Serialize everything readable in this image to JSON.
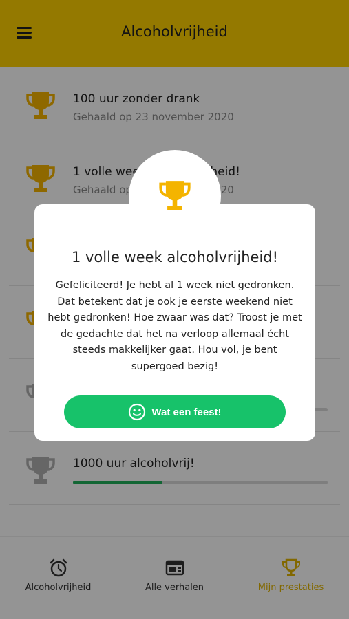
{
  "header": {
    "title": "Alcoholvrijheid",
    "menu_icon": "hamburger-menu-icon"
  },
  "achievements": [
    {
      "title": "100 uur zonder drank",
      "subtitle": "Gehaald op 23 november 2020",
      "achieved": true
    },
    {
      "title": "1 volle week alcoholvrijheid!",
      "subtitle": "Gehaald op 30 november 2020",
      "achieved": true
    },
    {
      "title": "",
      "subtitle": "",
      "achieved": true
    },
    {
      "title": "",
      "subtitle": "",
      "achieved": true
    },
    {
      "title": "",
      "subtitle": "",
      "achieved": false
    },
    {
      "title": "1000 uur alcoholvrij!",
      "subtitle": "",
      "achieved": false,
      "progress": 0.35
    }
  ],
  "bottom_nav": [
    {
      "label": "Alcoholvrijheid",
      "icon": "alarm-clock-icon",
      "active": false
    },
    {
      "label": "Alle verhalen",
      "icon": "stories-icon",
      "active": false
    },
    {
      "label": "Mijn prestaties",
      "icon": "trophy-icon",
      "active": true
    }
  ],
  "modal": {
    "title": "1 volle week alcoholvrijheid!",
    "body": "Gefeliciteerd! Je hebt al 1 week niet gedronken. Dat betekent dat je ook je eerste weekend niet hebt gedronken! Hoe zwaar was dat? Troost je met de gedachte dat het na verloop allemaal écht steeds makkelijker gaat. Hou vol, je bent supergoed bezig!",
    "button_label": "Wat een feest!",
    "button_icon": "smiley-icon"
  },
  "colors": {
    "accent": "#ffd100",
    "trophy_gold": "#f4b400",
    "trophy_gray": "#b0b0b0",
    "button_green": "#17c26a",
    "progress_green": "#1fb05a"
  }
}
